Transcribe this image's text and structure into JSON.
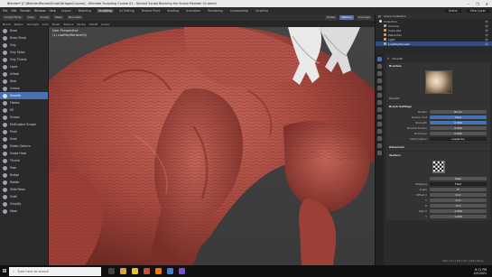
{
  "window": {
    "title": "Blender* [C:\\Blender\\Rendx\\Sculpt\\Dragon\\Course] - Ultimate Sculpting Course 01 - Second Sculpt Blocking the Sculpt Monster 01.blend",
    "controls": [
      "–",
      "❐",
      "✕"
    ]
  },
  "menubar": {
    "menus": [
      "File",
      "Edit",
      "Render",
      "Window",
      "Help"
    ],
    "workspaces": [
      "Layout",
      "Modeling",
      "Sculpting",
      "UV Editing",
      "Texture Paint",
      "Shading",
      "Animation",
      "Rendering",
      "Compositing",
      "Scripting"
    ],
    "active_workspace": "Sculpting",
    "scene": "Scene",
    "view_layer": "View Layer"
  },
  "header": {
    "mode": "Sculpt Mode",
    "items": [
      "View",
      "Sculpt",
      "Mask",
      "Face Sets"
    ],
    "right_items": [
      "Global",
      "Options",
      "Overlays"
    ]
  },
  "subheader": {
    "items": [
      "Brush",
      "Radius",
      "Strength",
      "Auto",
      "Brush",
      "Texture",
      "Stroke",
      "Falloff",
      "Cursor"
    ]
  },
  "viewport": {
    "info_line1": "User Perspective",
    "info_line2": "(1) LowPolyMonster(0)"
  },
  "tools": [
    {
      "label": "Draw",
      "color": "#9aa2b0"
    },
    {
      "label": "Draw Sharp",
      "color": "#9aa2b0"
    },
    {
      "label": "Clay",
      "color": "#9aa2b0"
    },
    {
      "label": "Clay Strips",
      "color": "#9aa2b0"
    },
    {
      "label": "Clay Thumb",
      "color": "#9aa2b0"
    },
    {
      "label": "Layer",
      "color": "#9aa2b0"
    },
    {
      "label": "Inflate",
      "color": "#9aa2b0"
    },
    {
      "label": "Blob",
      "color": "#9aa2b0"
    },
    {
      "label": "Crease",
      "color": "#9aa2b0"
    },
    {
      "label": "Smooth",
      "color": "#e0e0e0"
    },
    {
      "label": "Flatten",
      "color": "#9aa2b0"
    },
    {
      "label": "Fill",
      "color": "#9aa2b0"
    },
    {
      "label": "Scrape",
      "color": "#9aa2b0"
    },
    {
      "label": "Multi-plane Scrape",
      "color": "#9aa2b0"
    },
    {
      "label": "Pinch",
      "color": "#9aa2b0"
    },
    {
      "label": "Grab",
      "color": "#9aa2b0"
    },
    {
      "label": "Elastic Deform",
      "color": "#9aa2b0"
    },
    {
      "label": "Snake Hook",
      "color": "#9aa2b0"
    },
    {
      "label": "Thumb",
      "color": "#9aa2b0"
    },
    {
      "label": "Pose",
      "color": "#9aa2b0"
    },
    {
      "label": "Nudge",
      "color": "#9aa2b0"
    },
    {
      "label": "Rotate",
      "color": "#9aa2b0"
    },
    {
      "label": "Slide Relax",
      "color": "#9aa2b0"
    },
    {
      "label": "Cloth",
      "color": "#9aa2b0"
    },
    {
      "label": "Simplify",
      "color": "#9aa2b0"
    },
    {
      "label": "Mask",
      "color": "#9aa2b0"
    }
  ],
  "active_tool": "Smooth",
  "outliner": {
    "title": "Scene Collection",
    "rows": [
      {
        "label": "Collection",
        "color": "#cfcfcf",
        "selected": false
      },
      {
        "label": "Camera",
        "color": "#e0a050",
        "selected": false
      },
      {
        "label": "Cube.001",
        "color": "#e0a050",
        "selected": false
      },
      {
        "label": "Plane.001",
        "color": "#e0a050",
        "selected": false
      },
      {
        "label": "Light",
        "color": "#e0a050",
        "selected": false
      },
      {
        "label": "LowPolyMonster",
        "color": "#e0a050",
        "selected": true
      }
    ]
  },
  "properties": {
    "brush_name": "Smooth",
    "brushes_label": "Brushes",
    "brush_settings_label": "Brush Settings",
    "fields": [
      {
        "key": "Radius",
        "value": "60 px",
        "style": "v"
      },
      {
        "key": "Radius Unit",
        "value": "View",
        "style": "blue"
      },
      {
        "key": "Strength",
        "value": "0.500",
        "style": "blue"
      },
      {
        "key": "Normal Radius",
        "value": "0.500",
        "style": "v"
      },
      {
        "key": "Hardness",
        "value": "0.000",
        "style": "v"
      },
      {
        "key": "Deformation",
        "value": "Laplacian",
        "style": "dark"
      }
    ],
    "advanced_label": "Advanced",
    "texture_label": "Texture",
    "new_label": "New",
    "mapping": {
      "key": "Mapping",
      "value": "Tiled"
    },
    "lower_fields": [
      {
        "key": "Angle",
        "value": "0°"
      },
      {
        "key": "Offset X",
        "value": "0 m"
      },
      {
        "key": "Y",
        "value": "0 m"
      },
      {
        "key": "Z",
        "value": "0 m"
      },
      {
        "key": "Size X",
        "value": "1.000"
      },
      {
        "key": "Y",
        "value": "1.000"
      }
    ]
  },
  "statusbar": {
    "stats": "Verts 1.11 | Tris 2.39 | 2.90.1 Faces"
  },
  "taskbar": {
    "search_placeholder": "Type here to search",
    "time": "6:11 PM",
    "date": "4/5/2021"
  }
}
